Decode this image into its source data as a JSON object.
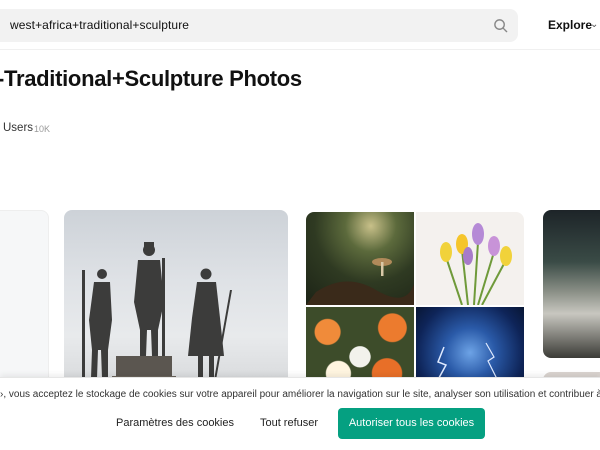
{
  "search": {
    "query": "west+africa+traditional+sculpture"
  },
  "nav": {
    "explore_label": "Explore"
  },
  "page": {
    "title": "-Traditional+Sculpture Photos"
  },
  "tabs": {
    "users_label": "Users",
    "users_count": "10K"
  },
  "cookie_banner": {
    "message": "›, vous acceptez le stockage de cookies sur votre appareil pour améliorer la navigation sur le site, analyser son utilisation et contribuer à nos eff",
    "settings_label": "Paramètres des cookies",
    "refuse_label": "Tout refuser",
    "accept_label": "Autoriser tous les cookies"
  },
  "colors": {
    "accept_button": "#05a081",
    "search_bg": "#f2f2f2"
  },
  "icons": {
    "search": "search-icon",
    "explore": "chevron-down-icon"
  }
}
